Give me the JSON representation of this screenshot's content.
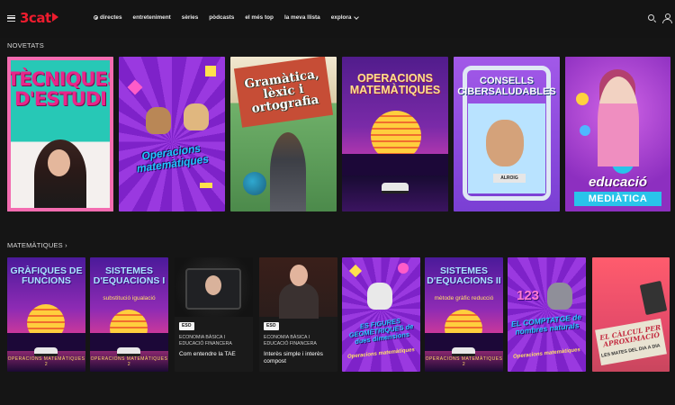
{
  "header": {
    "logo_text": "3cat",
    "nav": [
      {
        "label": "directes",
        "live": true
      },
      {
        "label": "entreteniment"
      },
      {
        "label": "sèries"
      },
      {
        "label": "pòdcasts"
      },
      {
        "label": "el més top"
      },
      {
        "label": "la meva llista"
      },
      {
        "label": "explora",
        "dropdown": true
      }
    ],
    "brand_color": "#ee1c2e"
  },
  "sections": [
    {
      "title": "NOVETATS",
      "cards": [
        {
          "title": "TÈCNIQUES D'ESTUDI"
        },
        {
          "title": "Operacions matemàtiques"
        },
        {
          "title": "Gramàtica, lèxic i ortografia"
        },
        {
          "title": "OPERACIONS MATEMÀTIQUES"
        },
        {
          "title": "CONSELLS CIBERSALUDABLES",
          "sign": "ALROIG"
        },
        {
          "title": "educació",
          "banner": "MEDIÀTICA"
        }
      ]
    },
    {
      "title": "MATEMÀTIQUES ›",
      "cards": [
        {
          "title": "GRÀFIQUES DE FUNCIONS",
          "footer": "OPERACIONS MATEMÀTIQUES 2"
        },
        {
          "title": "SISTEMES D'EQUACIONS I",
          "subtitle": "substitució igualació",
          "footer": "OPERACIONS MATEMÀTIQUES 2"
        },
        {
          "badge": "ESO",
          "caption": "ECONOMIA BÀSICA I EDUCACIÓ FINANCERA",
          "title": "Com entendre la TAE"
        },
        {
          "badge": "ESO",
          "caption": "ECONOMIA BÀSICA I EDUCACIÓ FINANCERA",
          "title": "Interès simple i interès compost"
        },
        {
          "title": "ES FIGURES GEOMÈTRIQUES de dues dimensions",
          "subtitle": "Operacions matemàtiques"
        },
        {
          "title": "SISTEMES D'EQUACIONS II",
          "subtitle": "mètode gràfic reducció",
          "footer": "OPERACIONS MATEMÀTIQUES 2"
        },
        {
          "numbers": "123",
          "title": "EL COMPTATGE de nombres naturals",
          "subtitle": "Operacions matemàtiques"
        },
        {
          "title": "EL CÀLCUL PER APROXIMACIÓ",
          "subtitle": "LES MATES DEL DIA A DIA"
        }
      ]
    }
  ]
}
